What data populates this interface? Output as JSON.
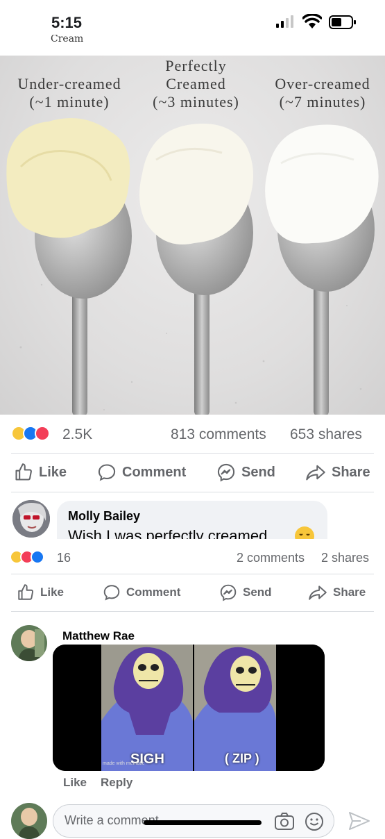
{
  "status_bar": {
    "time": "5:15"
  },
  "header": {
    "partial_title": "Cream"
  },
  "post": {
    "image_labels": {
      "left": "Under-creamed\n(~1 minute)",
      "middle": "Perfectly\nCreamed\n(~3 minutes)",
      "right": "Over-creamed\n(~7 minutes)"
    },
    "reaction_count": "2.5K",
    "comments_count": "813 comments",
    "shares_count": "653 shares",
    "actions": {
      "like": "Like",
      "comment": "Comment",
      "send": "Send",
      "share": "Share"
    }
  },
  "top_comment": {
    "author": "Molly Bailey",
    "text": "Wish I was perfectly creamed"
  },
  "comment_stats": {
    "reaction_count": "16",
    "comments_count": "2 comments",
    "shares_count": "2 shares",
    "actions": {
      "like": "Like",
      "comment": "Comment",
      "send": "Send",
      "share": "Share"
    }
  },
  "reply": {
    "author": "Matthew Rae",
    "meme_text_left": "SIGH",
    "meme_text_right": "( ZIP )",
    "meme_watermark": "made with mematic",
    "like_label": "Like",
    "reply_label": "Reply"
  },
  "composer": {
    "placeholder": "Write a comment..."
  },
  "colors": {
    "facebook_blue": "#1877f2",
    "love_red": "#f33e58",
    "haha_yellow": "#f7c63a",
    "muted_text": "#65676b"
  }
}
